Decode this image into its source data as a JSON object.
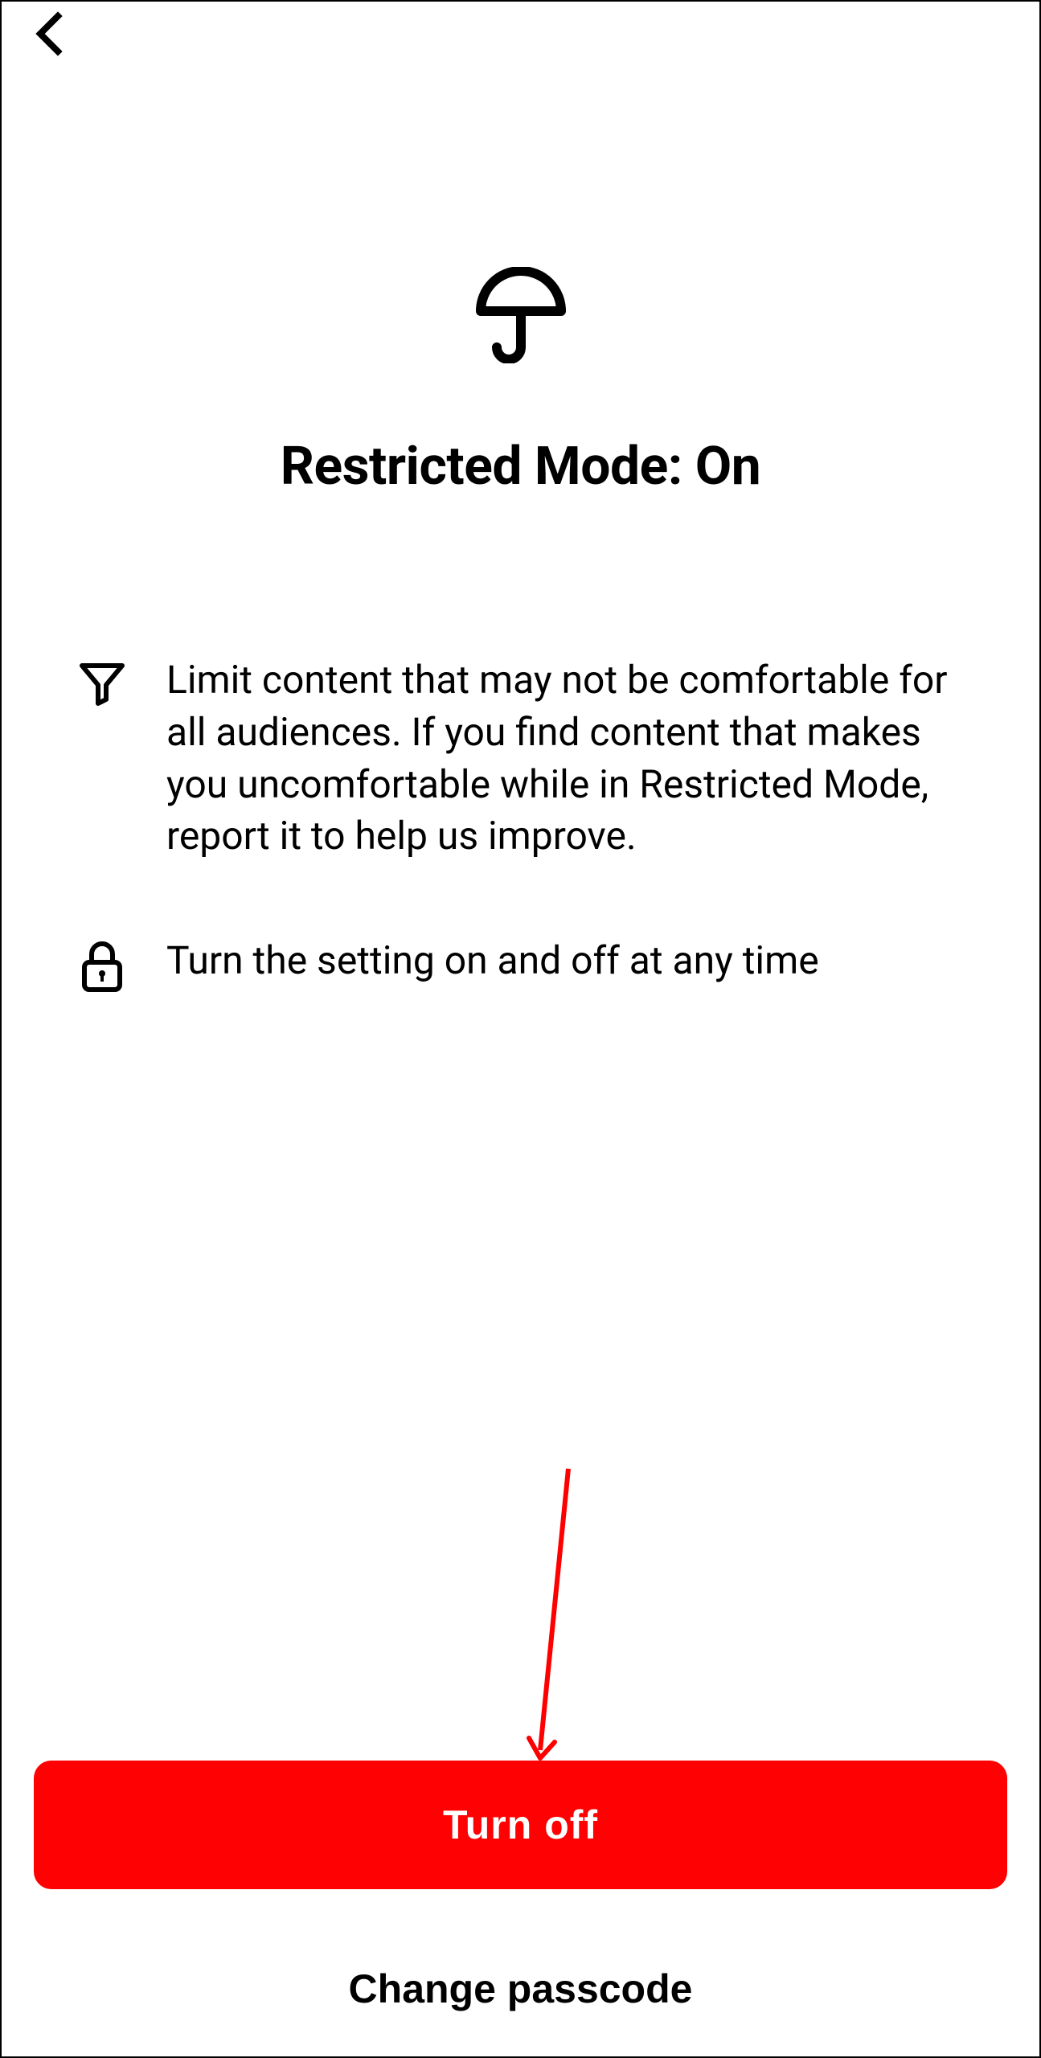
{
  "page": {
    "title": "Restricted Mode: On"
  },
  "info": {
    "filter_text": "Limit content that may not be comfortable for all audiences. If you find content that makes you uncomfortable while in Restricted Mode, report it to help us improve.",
    "lock_text": "Turn the setting on and off at any time"
  },
  "buttons": {
    "turn_off": "Turn off",
    "change_passcode": "Change passcode"
  },
  "colors": {
    "primary_button": "#fe0102",
    "annotation": "#ff0000"
  }
}
